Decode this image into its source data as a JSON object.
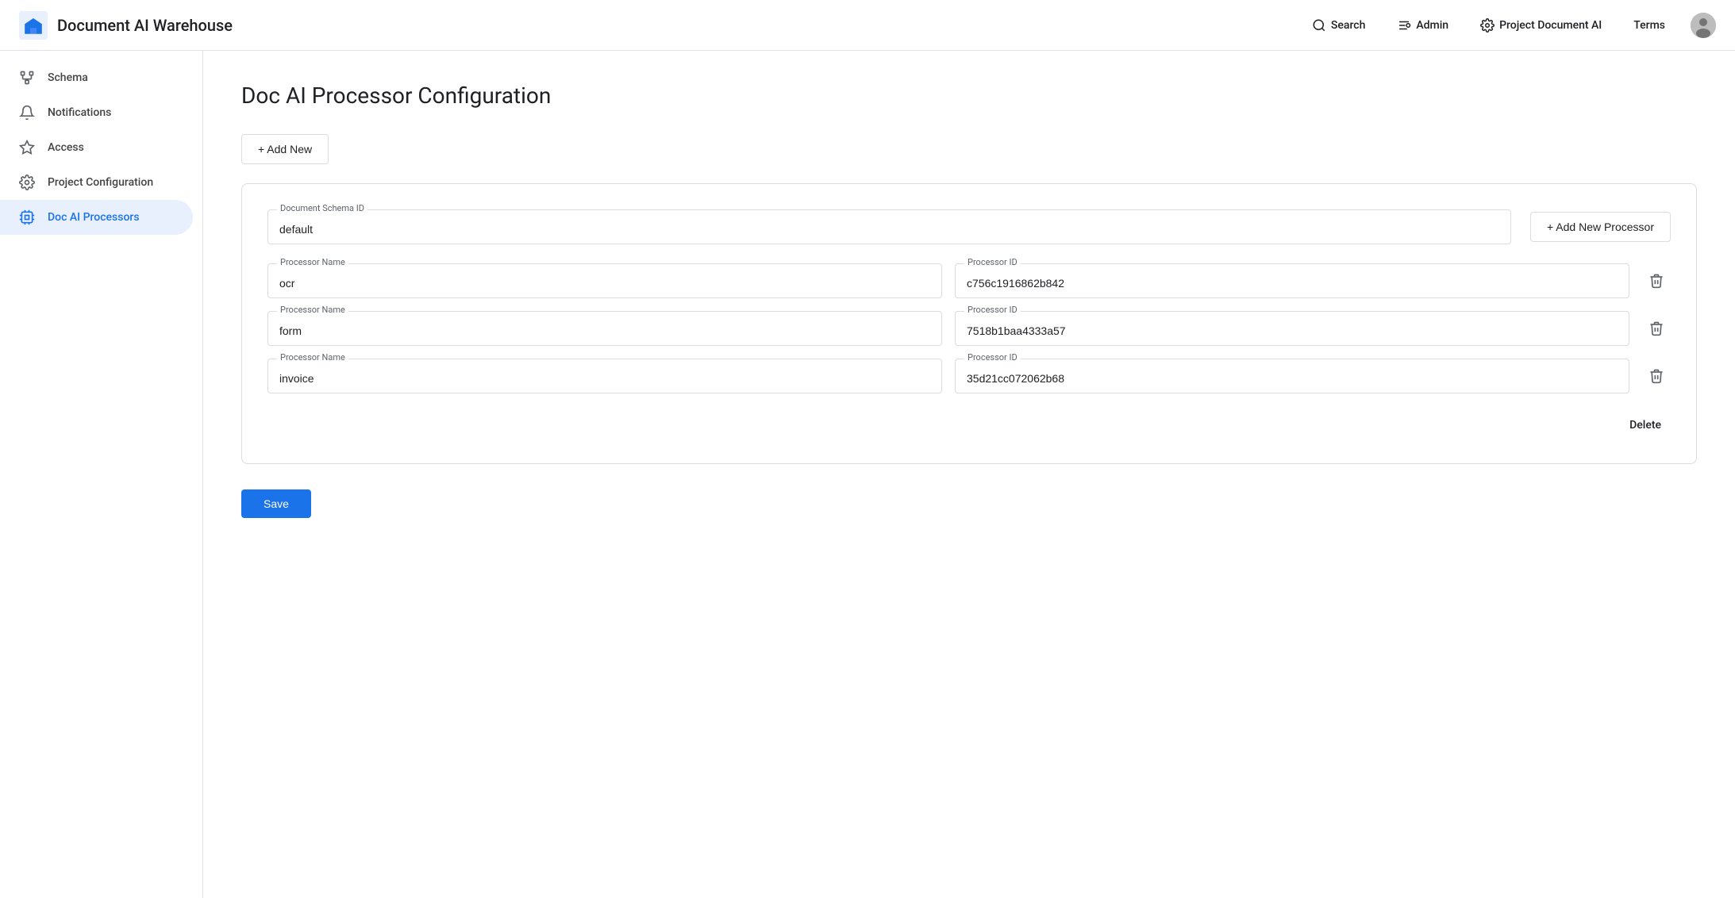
{
  "header": {
    "app_title": "Document AI Warehouse",
    "nav": [
      {
        "id": "search",
        "label": "Search",
        "icon": "search"
      },
      {
        "id": "admin",
        "label": "Admin",
        "icon": "admin"
      },
      {
        "id": "project",
        "label": "Project Document AI",
        "icon": "gear"
      },
      {
        "id": "terms",
        "label": "Terms",
        "icon": null
      }
    ]
  },
  "sidebar": {
    "items": [
      {
        "id": "schema",
        "label": "Schema",
        "icon": "schema"
      },
      {
        "id": "notifications",
        "label": "Notifications",
        "icon": "bell"
      },
      {
        "id": "access",
        "label": "Access",
        "icon": "access"
      },
      {
        "id": "project-configuration",
        "label": "Project Configuration",
        "icon": "settings"
      },
      {
        "id": "doc-ai-processors",
        "label": "Doc AI Processors",
        "icon": "processor",
        "active": true
      }
    ]
  },
  "main": {
    "page_title": "Doc AI Processor Configuration",
    "add_new_label": "+ Add New",
    "card": {
      "document_schema_id_label": "Document Schema ID",
      "document_schema_id_value": "default",
      "add_new_processor_label": "+ Add New Processor",
      "processors": [
        {
          "processor_name_label": "Processor Name",
          "processor_name_value": "ocr",
          "processor_id_label": "Processor ID",
          "processor_id_value": "c756c1916862b842"
        },
        {
          "processor_name_label": "Processor Name",
          "processor_name_value": "form",
          "processor_id_label": "Processor ID",
          "processor_id_value": "7518b1baa4333a57"
        },
        {
          "processor_name_label": "Processor Name",
          "processor_name_value": "invoice",
          "processor_id_label": "Processor ID",
          "processor_id_value": "35d21cc072062b68"
        }
      ],
      "delete_label": "Delete"
    },
    "save_label": "Save"
  }
}
